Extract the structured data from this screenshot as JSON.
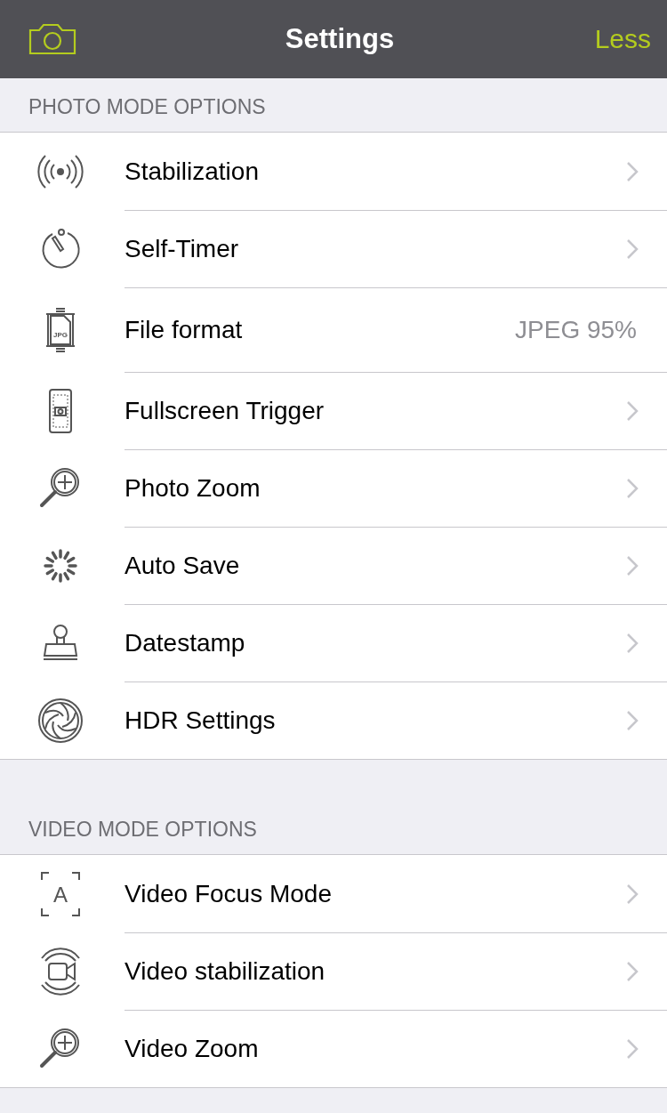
{
  "nav_bar": {
    "title": "Settings",
    "right_button": "Less"
  },
  "sections": [
    {
      "header": "PHOTO MODE OPTIONS",
      "rows": [
        {
          "label": "Stabilization",
          "kind": "link"
        },
        {
          "label": "Self-Timer",
          "kind": "link"
        },
        {
          "label": "File format",
          "kind": "value",
          "value": "JPEG 95%",
          "icon_text": "JPG"
        },
        {
          "label": "Fullscreen Trigger",
          "kind": "link"
        },
        {
          "label": "Photo Zoom",
          "kind": "link"
        },
        {
          "label": "Auto Save",
          "kind": "link"
        },
        {
          "label": "Datestamp",
          "kind": "link"
        },
        {
          "label": "HDR Settings",
          "kind": "link"
        }
      ]
    },
    {
      "header": "VIDEO MODE OPTIONS",
      "rows": [
        {
          "label": "Video Focus Mode",
          "kind": "link",
          "icon_text": "A"
        },
        {
          "label": "Video stabilization",
          "kind": "link"
        },
        {
          "label": "Video Zoom",
          "kind": "link"
        }
      ]
    }
  ]
}
